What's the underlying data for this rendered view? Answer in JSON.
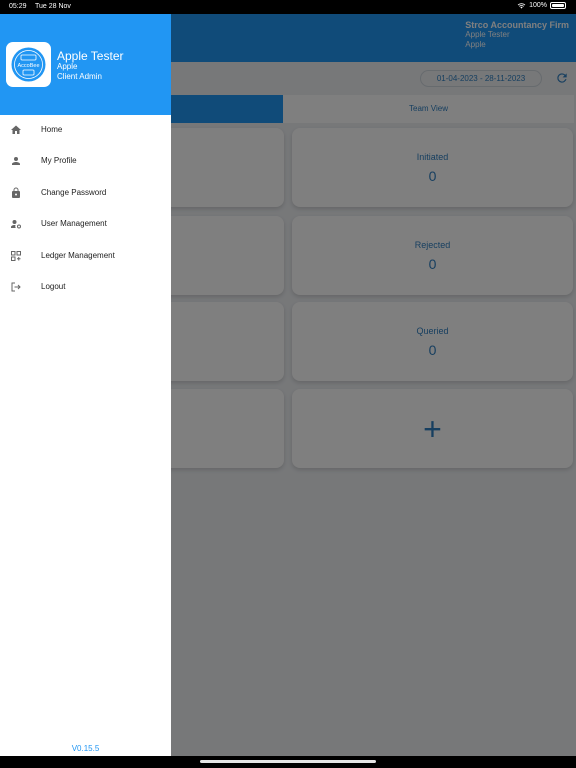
{
  "status_bar": {
    "time": "05:29",
    "date": "Tue 28 Nov",
    "battery": "100%"
  },
  "app_bar": {
    "firm_name": "Strco Accountancy Firm",
    "user": "Apple Tester",
    "company": "Apple"
  },
  "date_range": "01-04-2023 - 28-11-2023",
  "tabs": {
    "team_view": "Team View"
  },
  "cards": [
    {
      "label": "Initiated",
      "value": "0"
    },
    {
      "label": "Rejected",
      "value": "0"
    },
    {
      "label": "Queried",
      "value": "0"
    }
  ],
  "add_card": {
    "icon": "plus-icon",
    "symbol": "+"
  },
  "drawer": {
    "logo_text": "AccoBee",
    "user_name": "Apple Tester",
    "company": "Apple",
    "role": "Client Admin",
    "menu": [
      {
        "label": "Home",
        "icon": "home-icon"
      },
      {
        "label": "My Profile",
        "icon": "person-icon"
      },
      {
        "label": "Change Password",
        "icon": "lock-icon"
      },
      {
        "label": "User Management",
        "icon": "manage-accounts-icon"
      },
      {
        "label": "Ledger Management",
        "icon": "grid-add-icon"
      },
      {
        "label": "Logout",
        "icon": "logout-icon"
      }
    ],
    "version": "V0.15.5"
  },
  "colors": {
    "primary": "#2196f3",
    "accent_text": "#2f7fc0",
    "scrim": "rgba(0,0,0,0.5)"
  }
}
